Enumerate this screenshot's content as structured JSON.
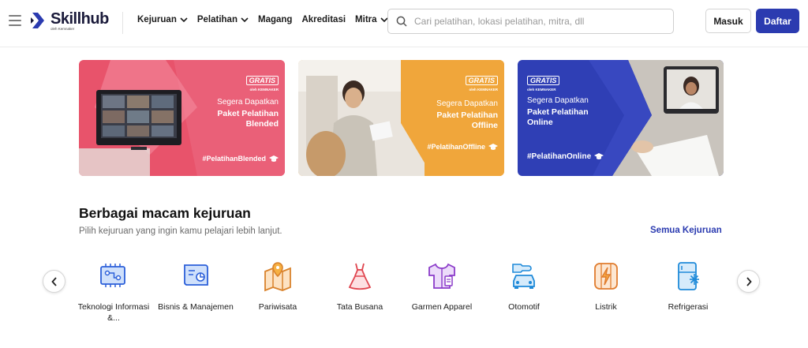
{
  "brand": {
    "name": "Skillhub",
    "subtitle": "oleh Kemnaker",
    "primary_color": "#2b3bb0"
  },
  "nav": {
    "items": [
      {
        "label": "Kejuruan",
        "has_dropdown": true
      },
      {
        "label": "Pelatihan",
        "has_dropdown": true
      },
      {
        "label": "Magang",
        "has_dropdown": false
      },
      {
        "label": "Akreditasi",
        "has_dropdown": false
      },
      {
        "label": "Mitra",
        "has_dropdown": true
      }
    ]
  },
  "search": {
    "placeholder": "Cari pelatihan, lokasi pelatihan, mitra, dll",
    "value": ""
  },
  "auth": {
    "login_label": "Masuk",
    "register_label": "Daftar"
  },
  "banners": [
    {
      "badge": "GRATIS",
      "badge_sub": "oleh KEMNAKER",
      "small": "Segera Dapatkan",
      "line1": "Paket Pelatihan",
      "line2": "Blended",
      "tag": "#PelatihanBlended",
      "color": "#e8536b"
    },
    {
      "badge": "GRATIS",
      "badge_sub": "oleh KEMNAKER",
      "small": "Segera Dapatkan",
      "line1": "Paket Pelatihan",
      "line2": "Offline",
      "tag": "#PelatihanOffline",
      "color": "#f0a63b"
    },
    {
      "badge": "GRATIS",
      "badge_sub": "oleh KEMNAKER",
      "small": "Segera Dapatkan",
      "line1": "Paket Pelatihan",
      "line2": "Online",
      "tag": "#PelatihanOnline",
      "color": "#2f3fb5"
    }
  ],
  "section": {
    "title": "Berbagai macam kejuruan",
    "subtitle": "Pilih kejuruan yang ingin kamu pelajari lebih lanjut.",
    "see_all": "Semua Kejuruan"
  },
  "categories": [
    {
      "label": "Teknologi Informasi &...",
      "icon": "technology-icon"
    },
    {
      "label": "Bisnis & Manajemen",
      "icon": "business-icon"
    },
    {
      "label": "Pariwisata",
      "icon": "map-pin-icon"
    },
    {
      "label": "Tata Busana",
      "icon": "dress-icon"
    },
    {
      "label": "Garmen Apparel",
      "icon": "shirt-icon"
    },
    {
      "label": "Otomotif",
      "icon": "car-icon"
    },
    {
      "label": "Listrik",
      "icon": "lightning-icon"
    },
    {
      "label": "Refrigerasi",
      "icon": "refrigerator-icon"
    }
  ]
}
